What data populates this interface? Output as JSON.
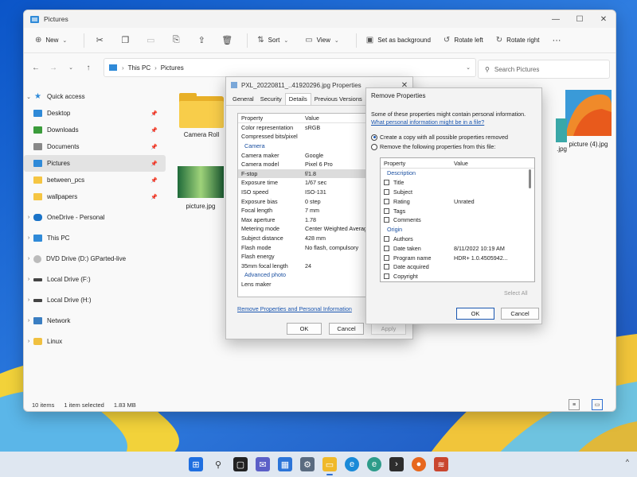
{
  "window": {
    "title": "Pictures"
  },
  "window_buttons": {
    "minimize": "—",
    "maximize": "☐",
    "close": "✕"
  },
  "commandbar": {
    "new_label": "New",
    "sort_label": "Sort",
    "view_label": "View",
    "set_background_label": "Set as background",
    "rotate_left_label": "Rotate left",
    "rotate_right_label": "Rotate right",
    "more_label": "···"
  },
  "address": {
    "crumbs": [
      "This PC",
      "Pictures"
    ],
    "separator": "›"
  },
  "search": {
    "placeholder": "Search Pictures"
  },
  "sidebar": {
    "items": [
      {
        "label": "Quick access",
        "icon": "star-icon"
      },
      {
        "label": "Desktop",
        "icon": "desktop-icon"
      },
      {
        "label": "Downloads",
        "icon": "download-icon"
      },
      {
        "label": "Documents",
        "icon": "documents-icon"
      },
      {
        "label": "Pictures",
        "icon": "pictures-icon"
      },
      {
        "label": "between_pcs",
        "icon": "folder-icon"
      },
      {
        "label": "wallpapers",
        "icon": "folder-icon"
      },
      {
        "label": "OneDrive - Personal",
        "icon": "cloud-icon"
      },
      {
        "label": "This PC",
        "icon": "computer-icon"
      },
      {
        "label": "DVD Drive (D:) GParted-live",
        "icon": "disc-icon"
      },
      {
        "label": "Local Drive (F:)",
        "icon": "drive-icon"
      },
      {
        "label": "Local Drive (H:)",
        "icon": "drive-icon"
      },
      {
        "label": "Network",
        "icon": "network-icon"
      },
      {
        "label": "Linux",
        "icon": "linux-icon"
      }
    ]
  },
  "files": [
    {
      "name": "Camera Roll",
      "type": "folder"
    },
    {
      "name": "picture.jpg",
      "type": "image"
    },
    {
      "name": "picture (4).jpg",
      "type": "image"
    },
    {
      "name": ".jpg",
      "type": "image"
    }
  ],
  "status": {
    "items": "10 items",
    "selected": "1 item selected",
    "size": "1.83 MB"
  },
  "properties_dialog": {
    "title": "PXL_20220811_..41920296.jpg Properties",
    "tabs": [
      "General",
      "Security",
      "Details",
      "Previous Versions"
    ],
    "active_tab": "Details",
    "columns": [
      "Property",
      "Value"
    ],
    "rows": [
      {
        "k": "Color representation",
        "v": "sRGB"
      },
      {
        "k": "Compressed bits/pixel",
        "v": ""
      },
      {
        "section": "Camera"
      },
      {
        "k": "Camera maker",
        "v": "Google"
      },
      {
        "k": "Camera model",
        "v": "Pixel 6 Pro"
      },
      {
        "k": "F-stop",
        "v": "f/1.8"
      },
      {
        "k": "Exposure time",
        "v": "1/67 sec"
      },
      {
        "k": "ISO speed",
        "v": "ISO-131"
      },
      {
        "k": "Exposure bias",
        "v": "0 step"
      },
      {
        "k": "Focal length",
        "v": "7 mm"
      },
      {
        "k": "Max aperture",
        "v": "1.78"
      },
      {
        "k": "Metering mode",
        "v": "Center Weighted Averag"
      },
      {
        "k": "Subject distance",
        "v": "428 mm"
      },
      {
        "k": "Flash mode",
        "v": "No flash, compulsory"
      },
      {
        "k": "Flash energy",
        "v": ""
      },
      {
        "k": "35mm focal length",
        "v": "24"
      },
      {
        "section": "Advanced photo"
      },
      {
        "k": "Lens maker",
        "v": ""
      }
    ],
    "link": "Remove Properties and Personal Information",
    "ok": "OK",
    "cancel": "Cancel",
    "apply": "Apply"
  },
  "remove_dialog": {
    "title": "Remove Properties",
    "info": "Some of these properties might contain personal information.",
    "link": "What personal information might be in a file?",
    "option1": "Create a copy with all possible properties removed",
    "option2": "Remove the following properties from this file:",
    "columns": [
      "Property",
      "Value"
    ],
    "rows": [
      {
        "section": "Description"
      },
      {
        "k": "Title",
        "v": ""
      },
      {
        "k": "Subject",
        "v": ""
      },
      {
        "k": "Rating",
        "v": "Unrated"
      },
      {
        "k": "Tags",
        "v": ""
      },
      {
        "k": "Comments",
        "v": ""
      },
      {
        "section": "Origin"
      },
      {
        "k": "Authors",
        "v": ""
      },
      {
        "k": "Date taken",
        "v": "8/11/2022 10:19 AM"
      },
      {
        "k": "Program name",
        "v": "HDR+ 1.0.4505942..."
      },
      {
        "k": "Date acquired",
        "v": ""
      },
      {
        "k": "Copyright",
        "v": ""
      }
    ],
    "select_all": "Select All",
    "ok": "OK",
    "cancel": "Cancel"
  },
  "taskbar": {
    "apps": [
      {
        "name": "start-icon",
        "color": "#1f6fe0"
      },
      {
        "name": "search-icon",
        "color": "#333333"
      },
      {
        "name": "task-view-icon",
        "color": "#222222"
      },
      {
        "name": "chat-icon",
        "color": "#5b5fc7"
      },
      {
        "name": "widgets-icon",
        "color": "#2b74d8"
      },
      {
        "name": "settings-icon",
        "color": "#5a6b80"
      },
      {
        "name": "file-explorer-icon",
        "color": "#f0b929"
      },
      {
        "name": "edge-icon",
        "color": "#1a8ad8"
      },
      {
        "name": "edge-canary-icon",
        "color": "#2e9c8a"
      },
      {
        "name": "terminal-icon",
        "color": "#2d2d2d"
      },
      {
        "name": "firefox-icon",
        "color": "#e7671e"
      },
      {
        "name": "app-icon",
        "color": "#c9462f"
      }
    ],
    "tray_label": "^"
  },
  "colors": {
    "accent": "#1a56b0",
    "folder": "#f8cd4a"
  }
}
